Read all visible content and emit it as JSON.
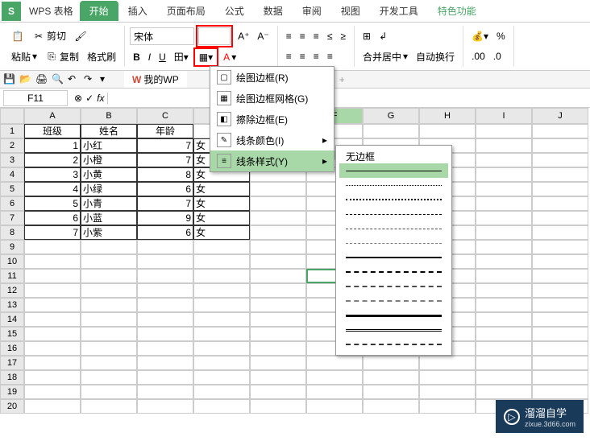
{
  "app": {
    "title": "WPS 表格",
    "logo": "S"
  },
  "tabs": {
    "start": "开始",
    "insert": "插入",
    "page_layout": "页面布局",
    "formula": "公式",
    "data": "数据",
    "review": "审阅",
    "view": "视图",
    "dev": "开发工具",
    "special": "特色功能"
  },
  "ribbon": {
    "paste": "粘贴",
    "cut": "剪切",
    "copy": "复制",
    "format_painter": "格式刷",
    "font": "宋体",
    "size": "",
    "bold": "B",
    "italic": "I",
    "underline": "U",
    "merge": "合并居中",
    "wrap": "自动换行"
  },
  "doc_tab": "我的WP",
  "name_box": "F11",
  "selected_col": "F",
  "cols": [
    "A",
    "B",
    "C",
    "D",
    "E",
    "F",
    "G",
    "H",
    "I",
    "J"
  ],
  "row_count": 20,
  "table": {
    "headers": [
      "班级",
      "姓名",
      "年龄"
    ],
    "rows": [
      [
        "1",
        "小红",
        "7",
        "女"
      ],
      [
        "2",
        "小橙",
        "7",
        "女"
      ],
      [
        "3",
        "小黄",
        "8",
        "女"
      ],
      [
        "4",
        "小绿",
        "6",
        "女"
      ],
      [
        "5",
        "小青",
        "7",
        "女"
      ],
      [
        "6",
        "小蓝",
        "9",
        "女"
      ],
      [
        "7",
        "小紫",
        "6",
        "女"
      ]
    ]
  },
  "border_menu": {
    "draw_border": "绘图边框(R)",
    "draw_grid": "绘图边框网格(G)",
    "erase": "擦除边框(E)",
    "line_color": "线条颜色(I)",
    "line_style": "线条样式(Y)"
  },
  "line_menu": {
    "none": "无边框"
  },
  "watermark": {
    "title": "溜溜自学",
    "url": "zixue.3d66.com"
  }
}
